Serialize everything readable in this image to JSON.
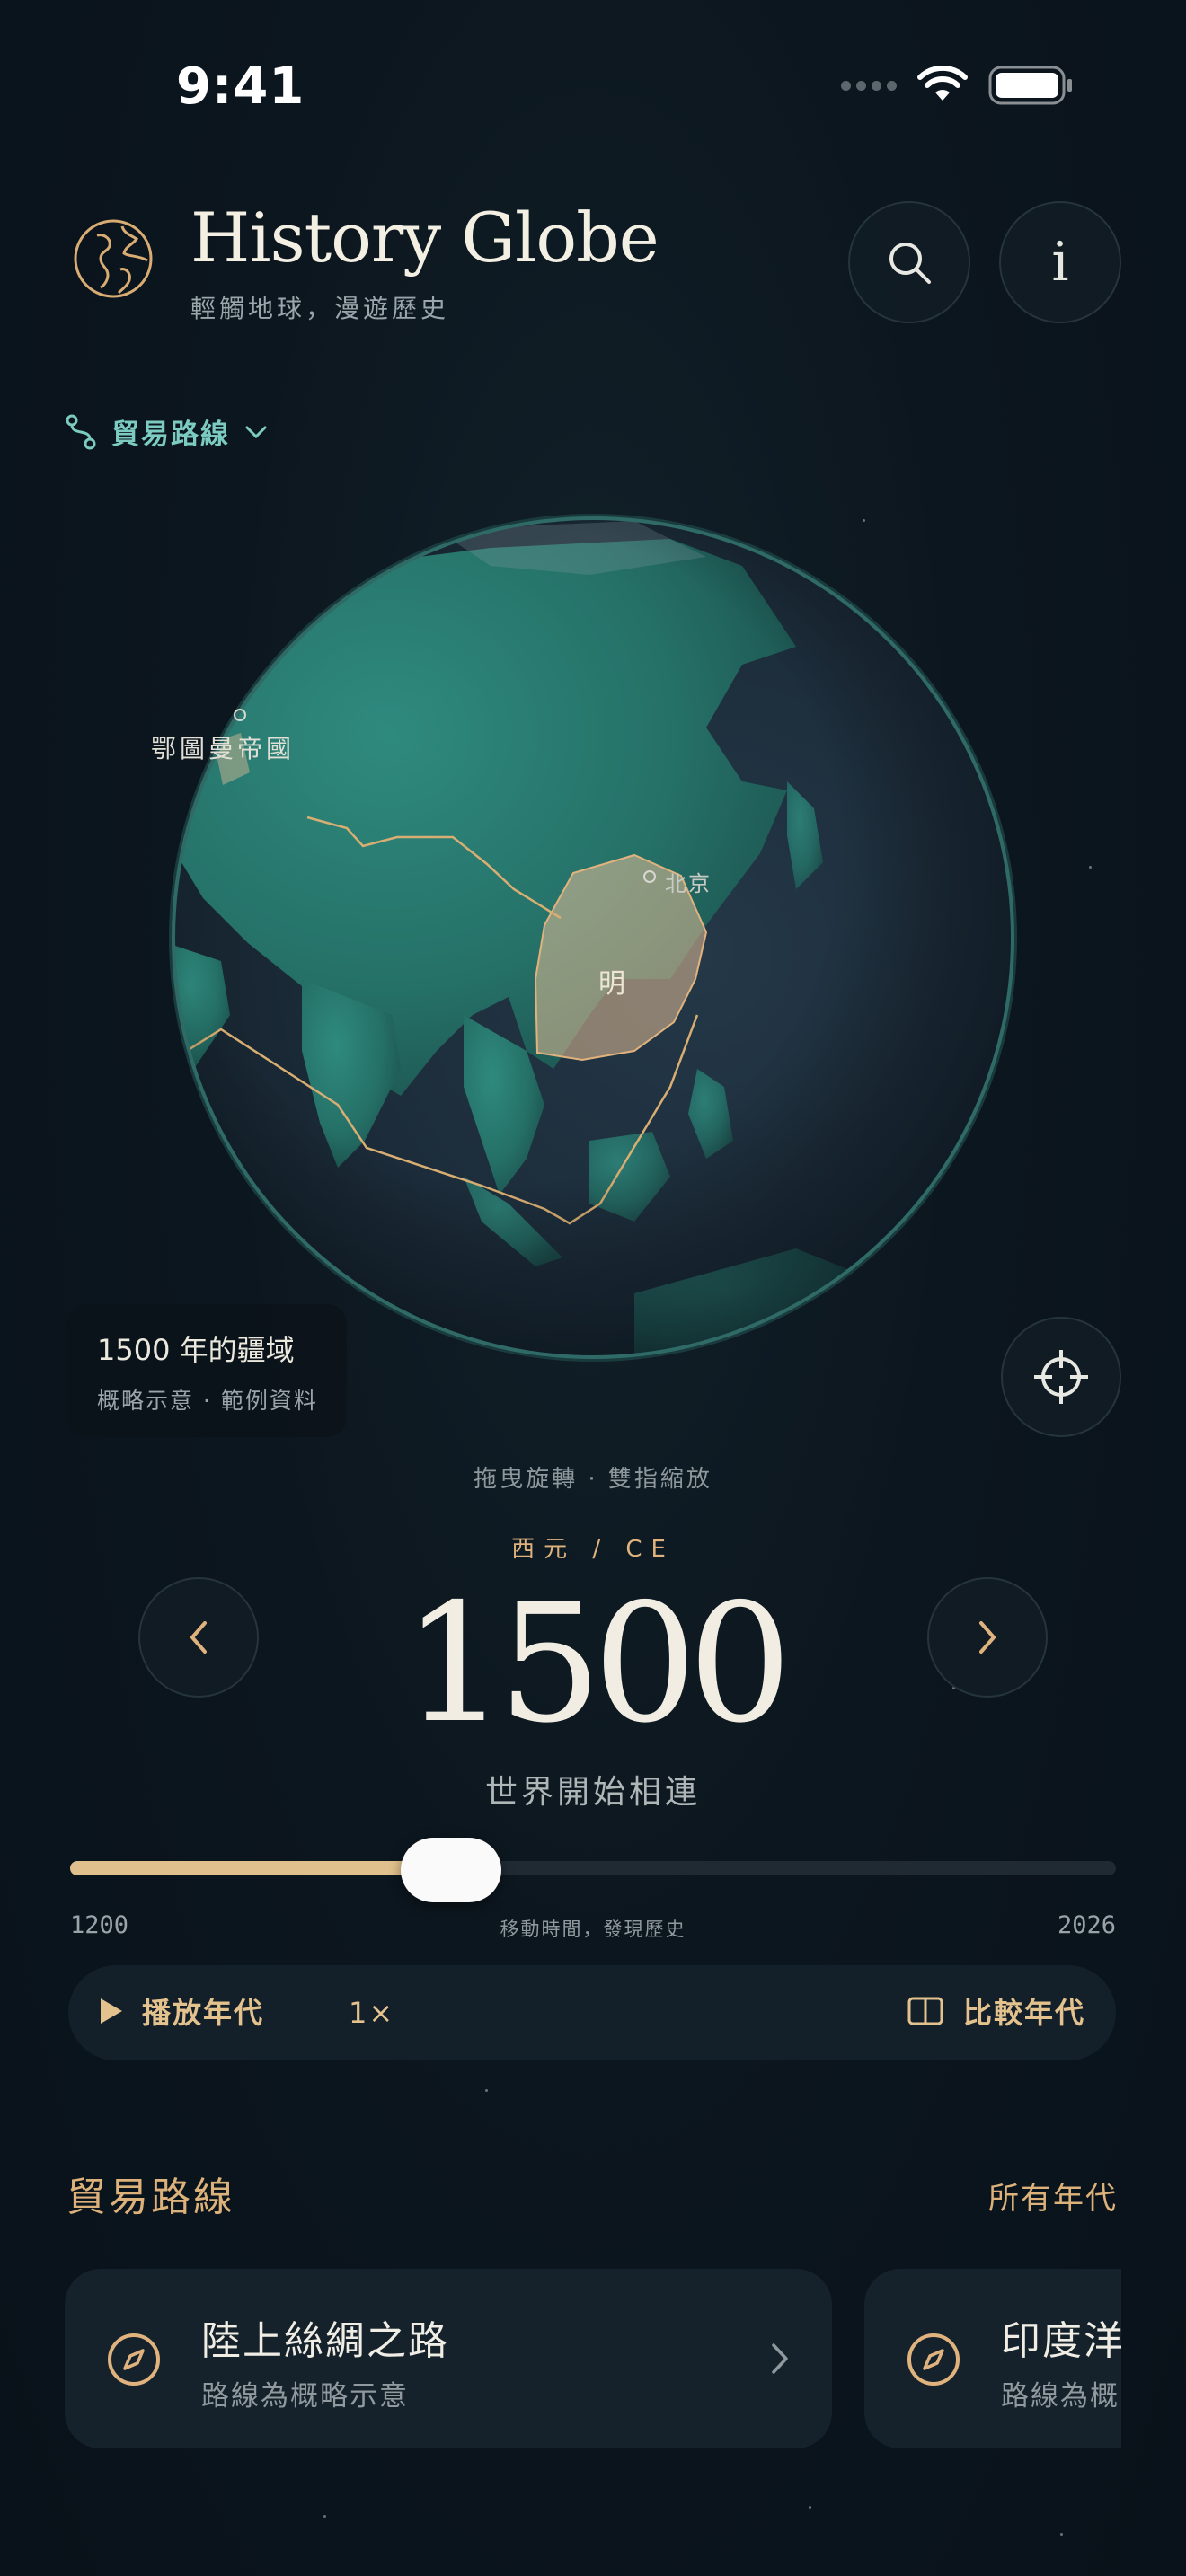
{
  "status": {
    "time": "9:41"
  },
  "header": {
    "title": "History Globe",
    "subtitle": "輕觸地球，漫遊歷史",
    "search_icon": "search-icon",
    "info_icon": "info-icon",
    "info_glyph": "i"
  },
  "layer": {
    "label": "貿易路線"
  },
  "globe": {
    "labels": {
      "ottoman": "鄂圖曼帝國",
      "beijing": "北京",
      "ming": "明"
    }
  },
  "extent_card": {
    "title": "1500 年的疆域",
    "subtitle": "概略示意 · 範例資料"
  },
  "hint": "拖曳旋轉 · 雙指縮放",
  "timeline": {
    "era": "西元 / CE",
    "year": "1500",
    "caption": "世界開始相連",
    "min": "1200",
    "max": "2026",
    "hint": "移動時間，發現歷史",
    "progress_fraction": 0.364
  },
  "playback": {
    "play_label": "播放年代",
    "speed": "1×",
    "compare_label": "比較年代"
  },
  "routes": {
    "title": "貿易路線",
    "all_link": "所有年代",
    "cards": [
      {
        "title": "陸上絲綢之路",
        "subtitle": "路線為概略示意"
      },
      {
        "title": "印度洋",
        "subtitle": "路線為概略示意"
      }
    ]
  },
  "colors": {
    "accent_gold": "#e0c08c",
    "teal": "#7ccbc0",
    "background": "#0c151d"
  }
}
